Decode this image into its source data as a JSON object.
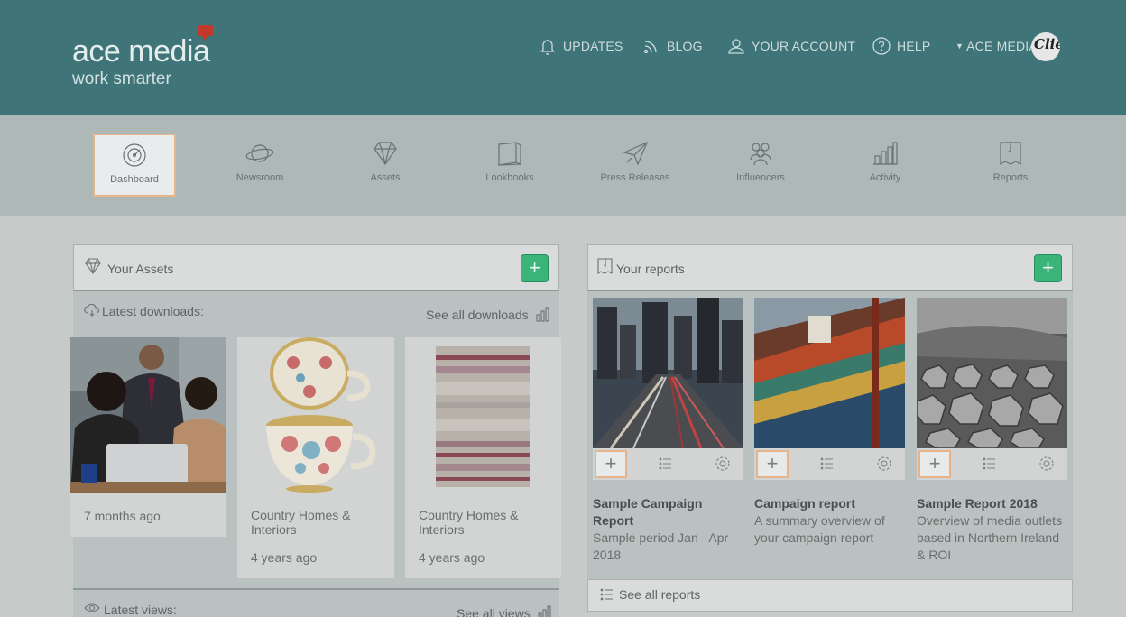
{
  "header": {
    "logo_main": "ace media",
    "logo_sub": "work smarter",
    "nav": {
      "updates": "UPDATES",
      "blog": "BLOG",
      "account": "YOUR ACCOUNT",
      "help": "HELP",
      "org": "ACE MEDIA"
    },
    "avatar_text": "Clie"
  },
  "modules": [
    {
      "label": "Dashboard",
      "icon": "dashboard-icon",
      "active": true
    },
    {
      "label": "Newsroom",
      "icon": "planet-icon"
    },
    {
      "label": "Assets",
      "icon": "diamond-icon"
    },
    {
      "label": "Lookbooks",
      "icon": "book-icon"
    },
    {
      "label": "Press Releases",
      "icon": "paper-plane-icon"
    },
    {
      "label": "Influencers",
      "icon": "people-icon"
    },
    {
      "label": "Activity",
      "icon": "bar-chart-icon"
    },
    {
      "label": "Reports",
      "icon": "report-icon"
    }
  ],
  "assets_panel": {
    "title": "Your Assets",
    "add": "+",
    "latest_downloads": "Latest downloads:",
    "see_all_downloads": "See all downloads",
    "downloads": [
      {
        "title": "",
        "time": "7 months ago"
      },
      {
        "title": "Country Homes & Interiors",
        "time": "4 years ago"
      },
      {
        "title": "Country Homes & Interiors",
        "time": "4 years ago"
      }
    ],
    "latest_views": "Latest views:",
    "see_all_views": "See all views"
  },
  "reports_panel": {
    "title": "Your reports",
    "add": "+",
    "reports": [
      {
        "title": "Sample Campaign Report",
        "desc": "Sample period Jan - Apr 2018"
      },
      {
        "title": "Campaign report",
        "desc": "A summary overview of your campaign report"
      },
      {
        "title": "Sample Report 2018",
        "desc": "Overview of media outlets based in Northern Ireland & ROI"
      }
    ],
    "see_all": "See all reports"
  },
  "colors": {
    "header": "#3f7579",
    "accent_green": "#3bb47a",
    "active_border": "#e5b48a"
  }
}
